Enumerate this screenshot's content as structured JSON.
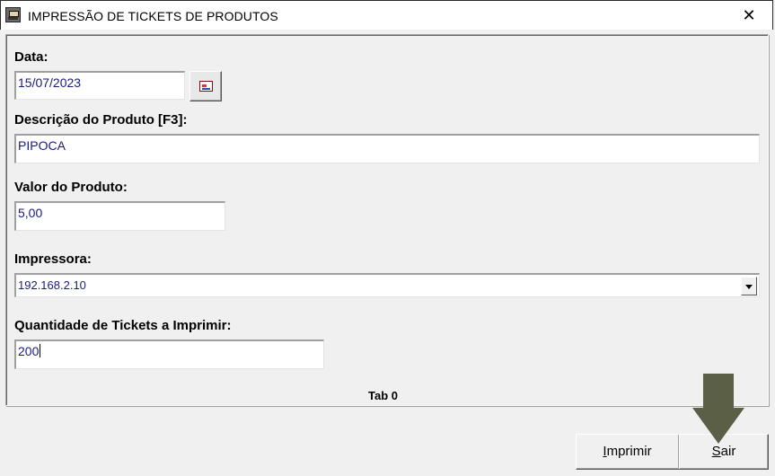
{
  "window": {
    "title": "IMPRESSÃO DE TICKETS DE PRODUTOS",
    "close_glyph": "✕"
  },
  "form": {
    "date_label": "Data:",
    "date_value": "15/07/2023",
    "description_label": "Descrição do Produto [F3]:",
    "description_value": "PIPOCA",
    "price_label": "Valor do Produto:",
    "price_value": "5,00",
    "printer_label": "Impressora:",
    "printer_value": "192.168.2.10",
    "quantity_label": "Quantidade de Tickets a Imprimir:",
    "quantity_value": "200"
  },
  "tab_label": "Tab 0",
  "buttons": {
    "print_first": "I",
    "print_rest": "mprimir",
    "exit_first": "S",
    "exit_rest": "air"
  },
  "icons": [
    "app-icon",
    "calendar-icon",
    "dropdown-arrow-icon",
    "close-icon",
    "down-arrow-annotation"
  ],
  "colors": {
    "field_text": "#1a1a80",
    "annotation_arrow": "#5b5f45"
  }
}
